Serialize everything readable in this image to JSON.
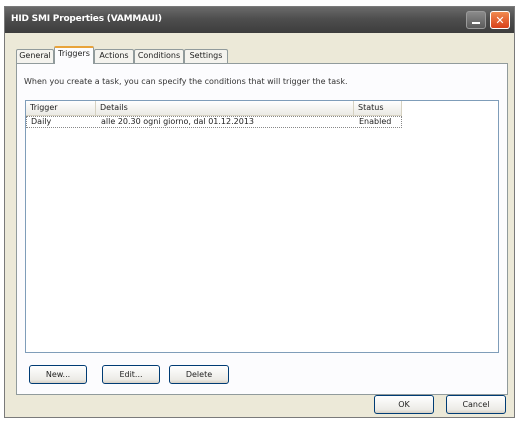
{
  "window": {
    "title": "HID SMI Properties (VAMMAUI)"
  },
  "tabs": [
    {
      "label": "General"
    },
    {
      "label": "Triggers"
    },
    {
      "label": "Actions"
    },
    {
      "label": "Conditions"
    },
    {
      "label": "Settings"
    }
  ],
  "active_tab": "Triggers",
  "triggers": {
    "description": "When you create a task, you can specify the conditions that will trigger the task.",
    "columns": [
      "Trigger",
      "Details",
      "Status"
    ],
    "rows": [
      {
        "trigger": "Daily",
        "details": "alle 20.30 ogni giorno, dal 01.12.2013",
        "status": "Enabled"
      }
    ],
    "buttons": {
      "new": "New...",
      "edit": "Edit...",
      "delete": "Delete"
    }
  },
  "footer": {
    "ok": "OK",
    "cancel": "Cancel"
  }
}
